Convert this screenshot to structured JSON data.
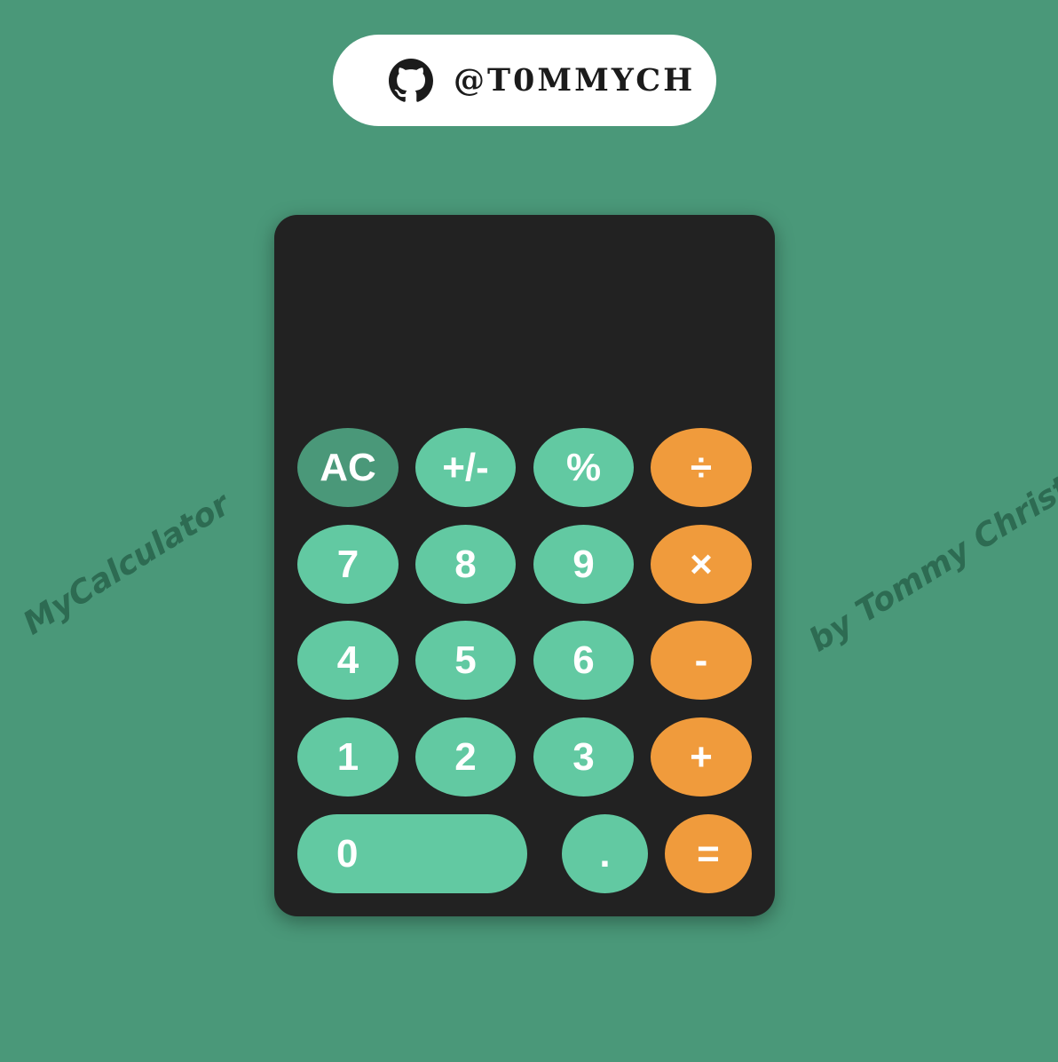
{
  "header": {
    "github_handle": "@T0MMYCH",
    "icon": "github-icon"
  },
  "side_labels": {
    "left": "MyCalculator",
    "right": "by Tommy Christ"
  },
  "calculator": {
    "display_value": "",
    "keys": {
      "ac": "AC",
      "sign": "+/-",
      "percent": "%",
      "divide": "÷",
      "seven": "7",
      "eight": "8",
      "nine": "9",
      "multiply": "×",
      "four": "4",
      "five": "5",
      "six": "6",
      "subtract": "-",
      "one": "1",
      "two": "2",
      "three": "3",
      "add": "+",
      "zero": "0",
      "decimal": ".",
      "equals": "="
    }
  },
  "colors": {
    "background": "#4a9879",
    "body": "#222222",
    "number_key": "#62c9a2",
    "function_key": "#4a9879",
    "operator_key": "#f09b3c"
  }
}
